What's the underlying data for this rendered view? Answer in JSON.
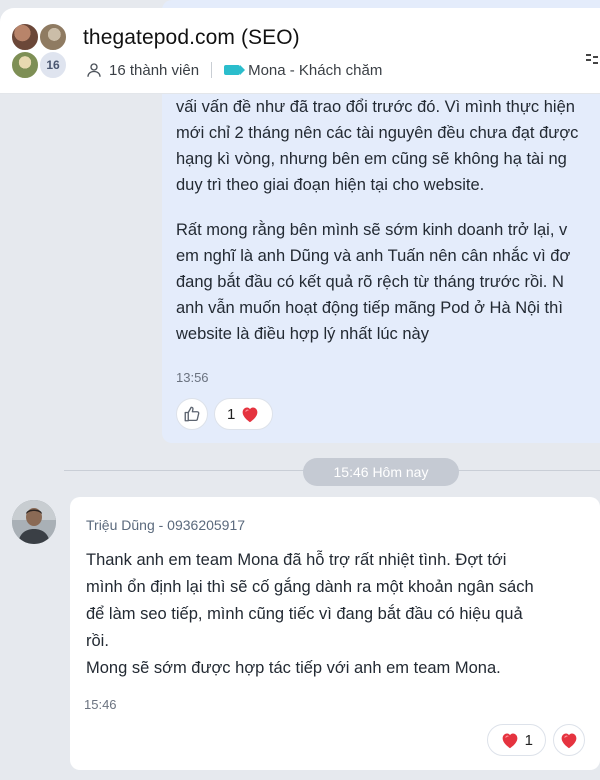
{
  "header": {
    "title": "thegatepod.com (SEO)",
    "members_count": "16",
    "members_label": "16 thành viên",
    "tag_label": "Mona - Khách chăm",
    "icons": [
      "users-icon",
      "tag-icon",
      "more-icon"
    ]
  },
  "outgoing": {
    "paragraph_1": "vấi vấn đề như đã trao đổi trước đó. Vì mình thực hiện\nmới chỉ 2 tháng nên các tài nguyên đều chưa đạt được\nhạng kì vòng, nhưng bên em cũng sẽ không hạ tài ng\nduy trì theo giai đoạn hiện tại cho website.",
    "paragraph_2": "Rất mong rằng bên mình sẽ sớm kinh doanh trở lại, v\nem nghĩ là anh Dũng và anh Tuấn nên cân nhắc vì đơ\nđang bắt đầu có kết quả rõ rệch từ tháng trước rồi. N\nanh vẫn muốn hoạt động tiếp mãng Pod ở Hà Nội thì\nwebsite là điều hợp lý nhất lúc này",
    "time": "13:56",
    "reaction_count": "1"
  },
  "divider_label": "15:46 Hôm nay",
  "incoming": {
    "sender": "Triệu Dũng - 0936205917",
    "message": "Thank anh em team Mona đã hỗ trợ rất nhiệt tình. Đợt tới\nmình ổn định lại thì sẽ cố gắng dành ra một khoản ngân sách\nđể làm seo tiếp, mình cũng tiếc vì đang bắt đầu có hiệu quả\nrồi.\nMong sẽ sớm được hợp tác tiếp với anh em team Mona.",
    "time": "15:46",
    "reaction_count": "1"
  },
  "colors": {
    "outgoing_bubble": "#e4ecfb",
    "incoming_bubble": "#ffffff",
    "background": "#e6e9ee",
    "tag": "#2bbdcc",
    "heart": "#e5333f"
  }
}
